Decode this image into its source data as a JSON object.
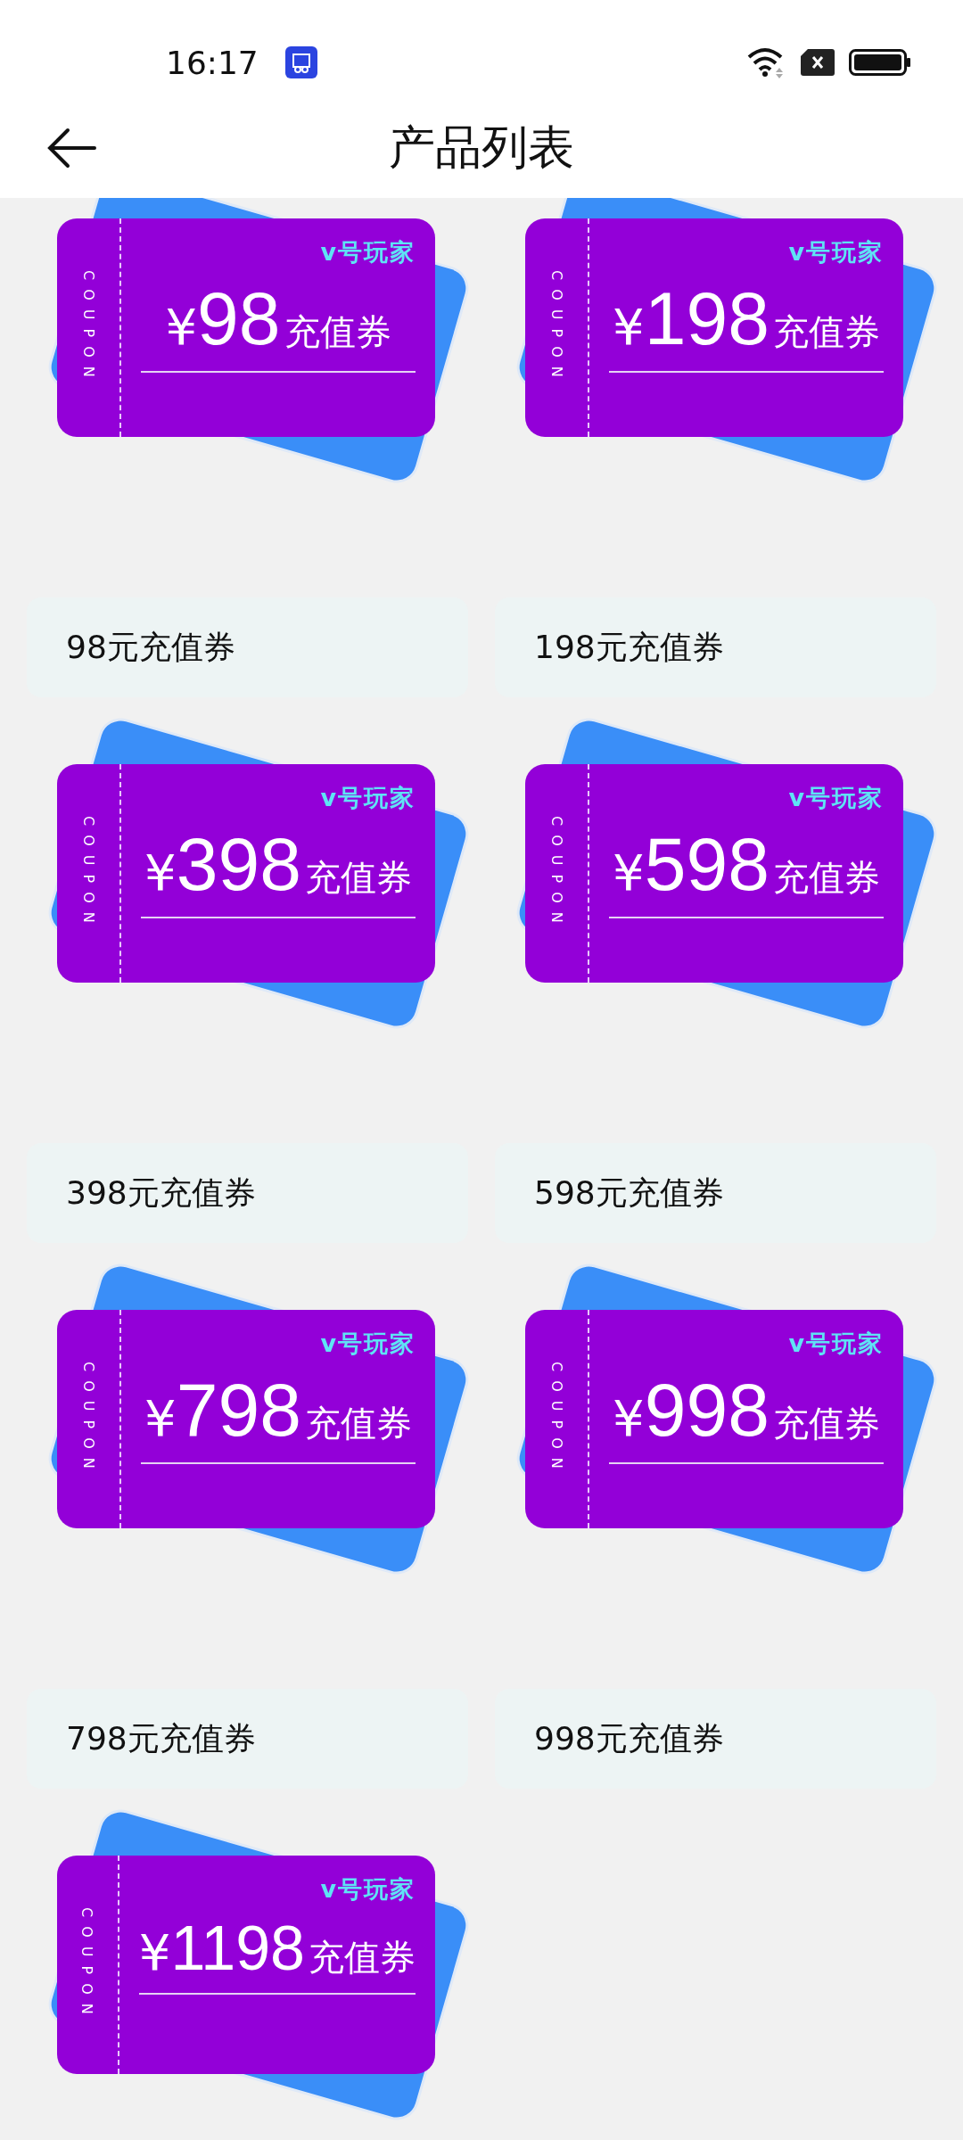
{
  "status_bar": {
    "time": "16:17"
  },
  "header": {
    "title": "产品列表"
  },
  "products": [
    {
      "brand": "v号玩家",
      "side_text": "COUPON",
      "currency": "¥",
      "amount": "98",
      "unit": "充值券",
      "caption": "98元充值券"
    },
    {
      "brand": "v号玩家",
      "side_text": "COUPON",
      "currency": "¥",
      "amount": "198",
      "unit": "充值券",
      "caption": "198元充值券"
    },
    {
      "brand": "v号玩家",
      "side_text": "COUPON",
      "currency": "¥",
      "amount": "398",
      "unit": "充值券",
      "caption": "398元充值券"
    },
    {
      "brand": "v号玩家",
      "side_text": "COUPON",
      "currency": "¥",
      "amount": "598",
      "unit": "充值券",
      "caption": "598元充值券"
    },
    {
      "brand": "v号玩家",
      "side_text": "COUPON",
      "currency": "¥",
      "amount": "798",
      "unit": "充值券",
      "caption": "798元充值券"
    },
    {
      "brand": "v号玩家",
      "side_text": "COUPON",
      "currency": "¥",
      "amount": "998",
      "unit": "充值券",
      "caption": "998元充值券"
    },
    {
      "brand": "v号玩家",
      "side_text": "COUPON",
      "currency": "¥",
      "amount": "1198",
      "unit": "充值券"
    }
  ]
}
